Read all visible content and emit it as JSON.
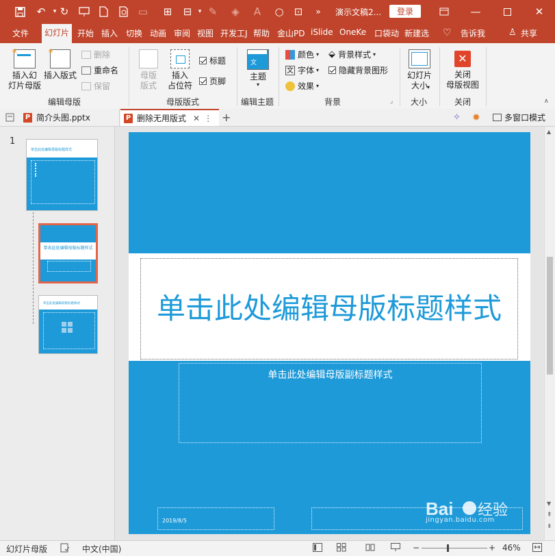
{
  "app": {
    "document_title": "演示文稿2...",
    "login_label": "登录",
    "accent_color": "#c0442b",
    "slide_color": "#1e9ad9"
  },
  "tabs": [
    {
      "label": "文件"
    },
    {
      "label": "幻灯片",
      "active": true
    },
    {
      "label": "开始"
    },
    {
      "label": "插入"
    },
    {
      "label": "切换"
    },
    {
      "label": "动画"
    },
    {
      "label": "审阅"
    },
    {
      "label": "视图"
    },
    {
      "label": "开发工J"
    },
    {
      "label": "帮助"
    },
    {
      "label": "金山PD"
    },
    {
      "label": "iSlide"
    },
    {
      "label": "OneKe"
    },
    {
      "label": "口袋动"
    },
    {
      "label": "新建选"
    },
    {
      "label": "告诉我"
    },
    {
      "label": "共享"
    }
  ],
  "ribbon": {
    "edit_master": {
      "insert_master_label": "插入幻\n灯片母版",
      "insert_layout_label": "插入版式",
      "delete_label": "删除",
      "rename_label": "重命名",
      "preserve_label": "保留",
      "group_label": "编辑母版"
    },
    "master_layout": {
      "master_layout_label": "母版\n版式",
      "insert_placeholder_label": "插入\n占位符",
      "title_checkbox_label": "标题",
      "footer_checkbox_label": "页脚",
      "group_label": "母版版式"
    },
    "edit_theme": {
      "theme_label": "主题",
      "group_label": "编辑主题"
    },
    "background": {
      "colors_label": "颜色",
      "fonts_label": "字体",
      "effects_label": "效果",
      "bg_styles_label": "背景样式",
      "hide_bg_label": "隐藏背景图形",
      "group_label": "背景"
    },
    "size": {
      "slide_size_label": "幻灯片\n大小",
      "group_label": "大小"
    },
    "close": {
      "close_master_label": "关闭\n母版视图",
      "group_label": "关闭"
    }
  },
  "doc_tabs": [
    {
      "label": "简介头图.pptx",
      "active": false
    },
    {
      "label": "删除无用版式",
      "active": true
    }
  ],
  "multi_window_label": "多窗口模式",
  "thumbnails": {
    "slide_number": "1",
    "thumb1_title": "单击此处编辑母版标题样式",
    "thumb2_title": "单击此处编辑母版标题样式",
    "thumb3_title": "单击此处编辑母版标题样式"
  },
  "slide": {
    "title": "单击此处编辑母版标题样式",
    "subtitle": "单击此处编辑母版副标题样式",
    "date": "2019/8/5"
  },
  "statusbar": {
    "view_label": "幻灯片母版",
    "language": "中文(中国)",
    "zoom": "46%",
    "zoom_fraction": 0.46
  },
  "watermark": {
    "logo_text": "Baidu经验",
    "url_text": "jingyan.baidu.com"
  }
}
